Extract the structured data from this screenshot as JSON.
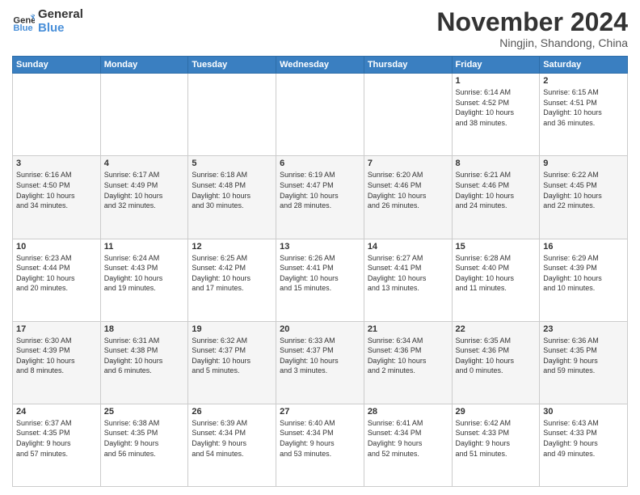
{
  "header": {
    "logo_general": "General",
    "logo_blue": "Blue",
    "month_title": "November 2024",
    "location": "Ningjin, Shandong, China"
  },
  "days_of_week": [
    "Sunday",
    "Monday",
    "Tuesday",
    "Wednesday",
    "Thursday",
    "Friday",
    "Saturday"
  ],
  "weeks": [
    [
      {
        "day": "",
        "info": ""
      },
      {
        "day": "",
        "info": ""
      },
      {
        "day": "",
        "info": ""
      },
      {
        "day": "",
        "info": ""
      },
      {
        "day": "",
        "info": ""
      },
      {
        "day": "1",
        "info": "Sunrise: 6:14 AM\nSunset: 4:52 PM\nDaylight: 10 hours\nand 38 minutes."
      },
      {
        "day": "2",
        "info": "Sunrise: 6:15 AM\nSunset: 4:51 PM\nDaylight: 10 hours\nand 36 minutes."
      }
    ],
    [
      {
        "day": "3",
        "info": "Sunrise: 6:16 AM\nSunset: 4:50 PM\nDaylight: 10 hours\nand 34 minutes."
      },
      {
        "day": "4",
        "info": "Sunrise: 6:17 AM\nSunset: 4:49 PM\nDaylight: 10 hours\nand 32 minutes."
      },
      {
        "day": "5",
        "info": "Sunrise: 6:18 AM\nSunset: 4:48 PM\nDaylight: 10 hours\nand 30 minutes."
      },
      {
        "day": "6",
        "info": "Sunrise: 6:19 AM\nSunset: 4:47 PM\nDaylight: 10 hours\nand 28 minutes."
      },
      {
        "day": "7",
        "info": "Sunrise: 6:20 AM\nSunset: 4:46 PM\nDaylight: 10 hours\nand 26 minutes."
      },
      {
        "day": "8",
        "info": "Sunrise: 6:21 AM\nSunset: 4:46 PM\nDaylight: 10 hours\nand 24 minutes."
      },
      {
        "day": "9",
        "info": "Sunrise: 6:22 AM\nSunset: 4:45 PM\nDaylight: 10 hours\nand 22 minutes."
      }
    ],
    [
      {
        "day": "10",
        "info": "Sunrise: 6:23 AM\nSunset: 4:44 PM\nDaylight: 10 hours\nand 20 minutes."
      },
      {
        "day": "11",
        "info": "Sunrise: 6:24 AM\nSunset: 4:43 PM\nDaylight: 10 hours\nand 19 minutes."
      },
      {
        "day": "12",
        "info": "Sunrise: 6:25 AM\nSunset: 4:42 PM\nDaylight: 10 hours\nand 17 minutes."
      },
      {
        "day": "13",
        "info": "Sunrise: 6:26 AM\nSunset: 4:41 PM\nDaylight: 10 hours\nand 15 minutes."
      },
      {
        "day": "14",
        "info": "Sunrise: 6:27 AM\nSunset: 4:41 PM\nDaylight: 10 hours\nand 13 minutes."
      },
      {
        "day": "15",
        "info": "Sunrise: 6:28 AM\nSunset: 4:40 PM\nDaylight: 10 hours\nand 11 minutes."
      },
      {
        "day": "16",
        "info": "Sunrise: 6:29 AM\nSunset: 4:39 PM\nDaylight: 10 hours\nand 10 minutes."
      }
    ],
    [
      {
        "day": "17",
        "info": "Sunrise: 6:30 AM\nSunset: 4:39 PM\nDaylight: 10 hours\nand 8 minutes."
      },
      {
        "day": "18",
        "info": "Sunrise: 6:31 AM\nSunset: 4:38 PM\nDaylight: 10 hours\nand 6 minutes."
      },
      {
        "day": "19",
        "info": "Sunrise: 6:32 AM\nSunset: 4:37 PM\nDaylight: 10 hours\nand 5 minutes."
      },
      {
        "day": "20",
        "info": "Sunrise: 6:33 AM\nSunset: 4:37 PM\nDaylight: 10 hours\nand 3 minutes."
      },
      {
        "day": "21",
        "info": "Sunrise: 6:34 AM\nSunset: 4:36 PM\nDaylight: 10 hours\nand 2 minutes."
      },
      {
        "day": "22",
        "info": "Sunrise: 6:35 AM\nSunset: 4:36 PM\nDaylight: 10 hours\nand 0 minutes."
      },
      {
        "day": "23",
        "info": "Sunrise: 6:36 AM\nSunset: 4:35 PM\nDaylight: 9 hours\nand 59 minutes."
      }
    ],
    [
      {
        "day": "24",
        "info": "Sunrise: 6:37 AM\nSunset: 4:35 PM\nDaylight: 9 hours\nand 57 minutes."
      },
      {
        "day": "25",
        "info": "Sunrise: 6:38 AM\nSunset: 4:35 PM\nDaylight: 9 hours\nand 56 minutes."
      },
      {
        "day": "26",
        "info": "Sunrise: 6:39 AM\nSunset: 4:34 PM\nDaylight: 9 hours\nand 54 minutes."
      },
      {
        "day": "27",
        "info": "Sunrise: 6:40 AM\nSunset: 4:34 PM\nDaylight: 9 hours\nand 53 minutes."
      },
      {
        "day": "28",
        "info": "Sunrise: 6:41 AM\nSunset: 4:34 PM\nDaylight: 9 hours\nand 52 minutes."
      },
      {
        "day": "29",
        "info": "Sunrise: 6:42 AM\nSunset: 4:33 PM\nDaylight: 9 hours\nand 51 minutes."
      },
      {
        "day": "30",
        "info": "Sunrise: 6:43 AM\nSunset: 4:33 PM\nDaylight: 9 hours\nand 49 minutes."
      }
    ]
  ]
}
